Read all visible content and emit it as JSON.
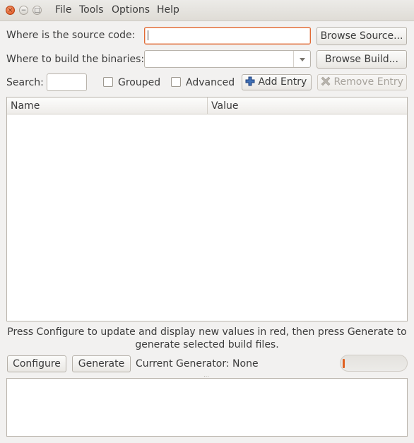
{
  "window": {
    "close_glyph": "×",
    "min_glyph": "−",
    "max_glyph": "□"
  },
  "menubar": {
    "items": [
      "File",
      "Tools",
      "Options",
      "Help"
    ]
  },
  "source": {
    "label": "Where is the source code:",
    "value": "",
    "browse_label": "Browse Source..."
  },
  "build": {
    "label": "Where to build the binaries:",
    "value": "",
    "browse_label": "Browse Build..."
  },
  "search": {
    "label": "Search:",
    "value": ""
  },
  "options": {
    "grouped_label": "Grouped",
    "grouped_checked": false,
    "advanced_label": "Advanced",
    "advanced_checked": false
  },
  "entries": {
    "add_label": "Add Entry",
    "remove_label": "Remove Entry"
  },
  "table": {
    "columns": [
      "Name",
      "Value"
    ],
    "rows": []
  },
  "message": "Press Configure to update and display new values in red, then press Generate to generate selected build files.",
  "actions": {
    "configure_label": "Configure",
    "generate_label": "Generate",
    "current_generator": "Current Generator: None"
  },
  "progress": {
    "value_fraction": 0.03,
    "accent": "#e0601f"
  },
  "icons": {
    "add": "plus-icon",
    "remove": "x-icon"
  }
}
